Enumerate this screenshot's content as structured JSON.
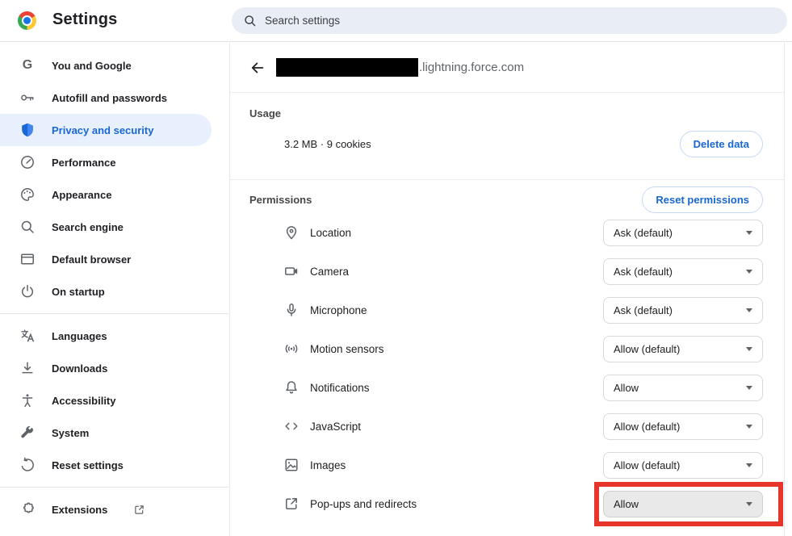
{
  "header": {
    "app_title": "Settings",
    "search_placeholder": "Search settings",
    "logo_icon": "chrome-logo-icon",
    "search_icon": "search-icon"
  },
  "sidebar": {
    "primary": [
      {
        "label": "You and Google",
        "icon": "google-g-icon",
        "selected": false
      },
      {
        "label": "Autofill and passwords",
        "icon": "key-icon",
        "selected": false
      },
      {
        "label": "Privacy and security",
        "icon": "shield-icon",
        "selected": true
      },
      {
        "label": "Performance",
        "icon": "speedometer-icon",
        "selected": false
      },
      {
        "label": "Appearance",
        "icon": "palette-icon",
        "selected": false
      },
      {
        "label": "Search engine",
        "icon": "search-icon",
        "selected": false
      },
      {
        "label": "Default browser",
        "icon": "browser-window-icon",
        "selected": false
      },
      {
        "label": "On startup",
        "icon": "power-icon",
        "selected": false
      }
    ],
    "secondary": [
      {
        "label": "Languages",
        "icon": "translate-icon"
      },
      {
        "label": "Downloads",
        "icon": "download-icon"
      },
      {
        "label": "Accessibility",
        "icon": "accessibility-icon"
      },
      {
        "label": "System",
        "icon": "wrench-icon"
      },
      {
        "label": "Reset settings",
        "icon": "reset-icon"
      }
    ],
    "footer": {
      "label": "Extensions",
      "icon": "puzzle-icon",
      "trailing_icon": "external-link-icon"
    }
  },
  "content": {
    "site_header": {
      "back_icon": "back-arrow-icon",
      "site_redacted": true,
      "domain_suffix": ".lightning.force.com"
    },
    "usage": {
      "label": "Usage",
      "summary": "3.2 MB · 9 cookies",
      "delete_button": "Delete data"
    },
    "permissions": {
      "label": "Permissions",
      "reset_button": "Reset permissions",
      "rows": [
        {
          "label": "Location",
          "icon": "location-pin-icon",
          "value": "Ask (default)",
          "highlighted": false
        },
        {
          "label": "Camera",
          "icon": "video-camera-icon",
          "value": "Ask (default)",
          "highlighted": false
        },
        {
          "label": "Microphone",
          "icon": "microphone-icon",
          "value": "Ask (default)",
          "highlighted": false
        },
        {
          "label": "Motion sensors",
          "icon": "motion-sensors-icon",
          "value": "Allow (default)",
          "highlighted": false
        },
        {
          "label": "Notifications",
          "icon": "bell-icon",
          "value": "Allow",
          "highlighted": false
        },
        {
          "label": "JavaScript",
          "icon": "code-icon",
          "value": "Allow (default)",
          "highlighted": false
        },
        {
          "label": "Images",
          "icon": "image-icon",
          "value": "Allow (default)",
          "highlighted": false
        },
        {
          "label": "Pop-ups and redirects",
          "icon": "popup-icon",
          "value": "Allow",
          "highlighted": true
        }
      ]
    }
  },
  "colors": {
    "accent_blue": "#1967d2",
    "selected_item_bg": "#e8f0fe",
    "search_bg": "#e9edf6",
    "annotation_red": "#e8352b",
    "highlighted_dropdown_bg": "#e9e9e9",
    "icon_gray": "#5f6368"
  }
}
